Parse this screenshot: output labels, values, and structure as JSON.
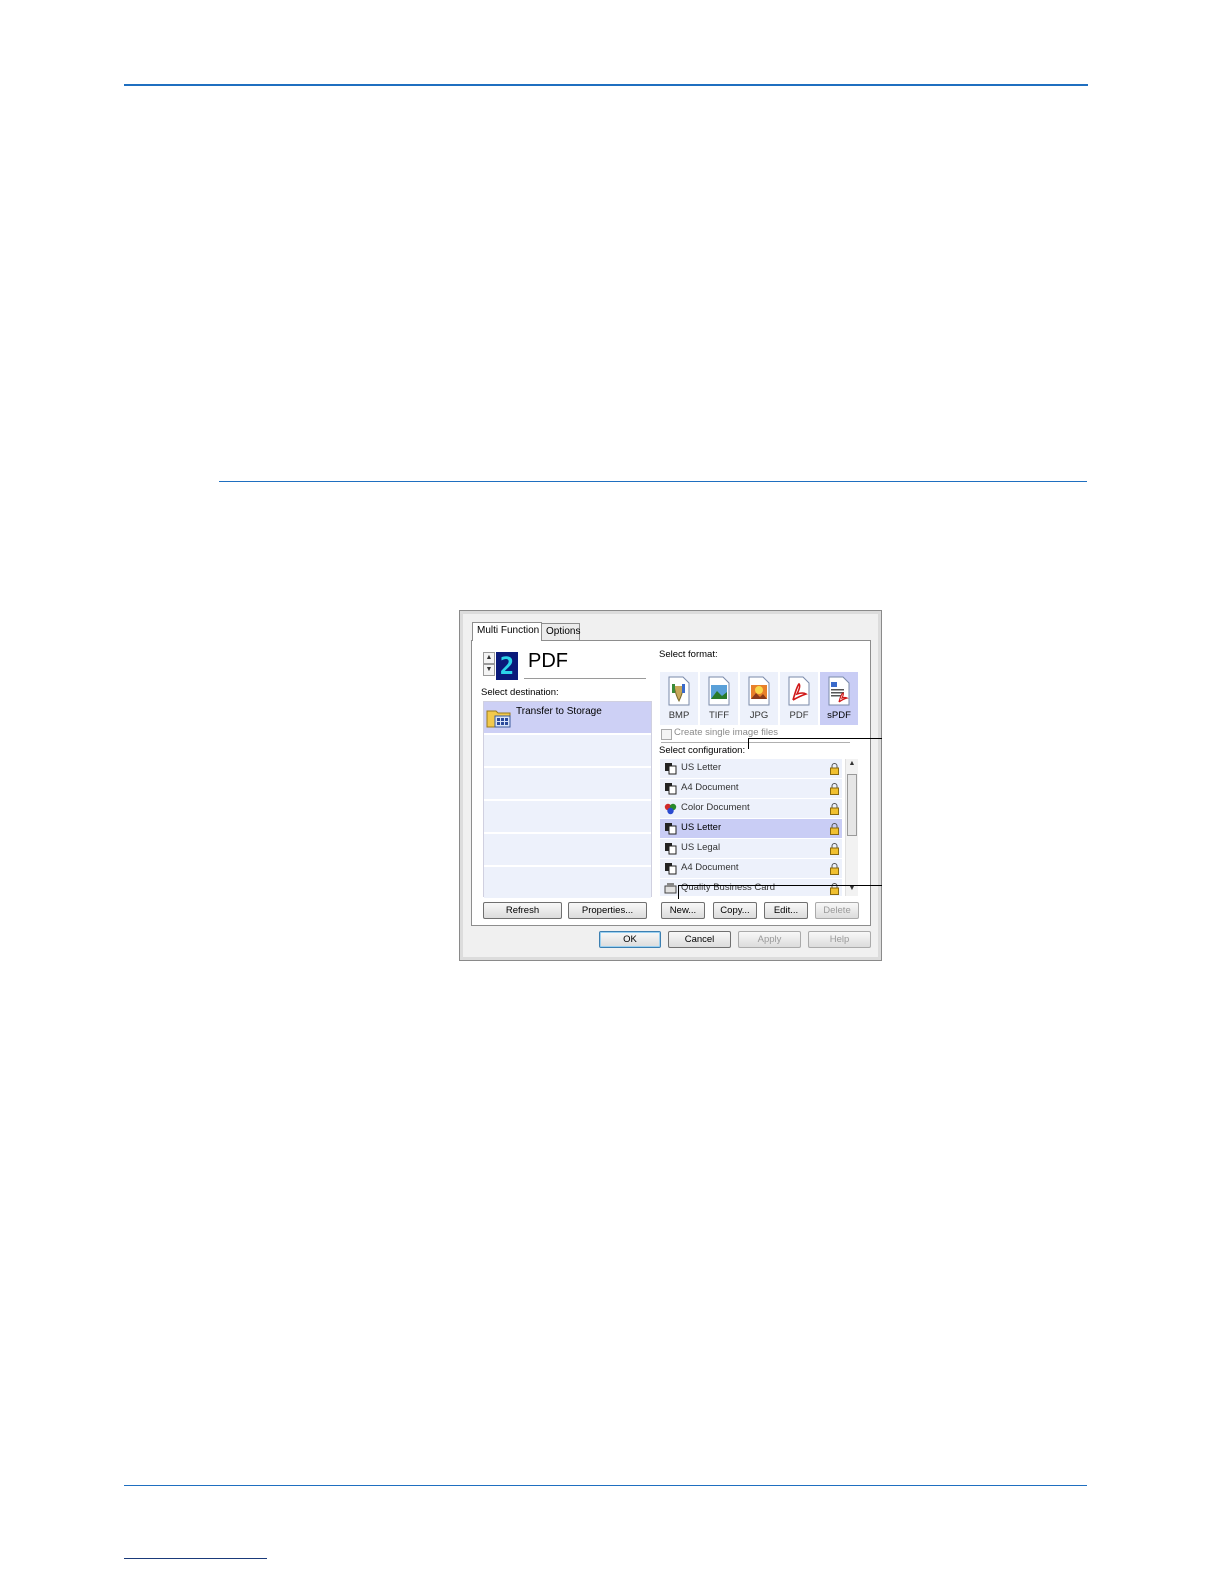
{
  "dialog": {
    "tabs": [
      "Multi Function",
      "Options"
    ],
    "profile": {
      "number": "2",
      "name": "PDF"
    },
    "select_destination_label": "Select destination:",
    "destinations": [
      {
        "label": "Transfer to Storage",
        "selected": true
      },
      {
        "label": ""
      },
      {
        "label": ""
      },
      {
        "label": ""
      },
      {
        "label": ""
      },
      {
        "label": ""
      }
    ],
    "select_format_label": "Select format:",
    "formats": [
      {
        "label": "BMP",
        "icon": "bmp-file-icon"
      },
      {
        "label": "TIFF",
        "icon": "tiff-file-icon"
      },
      {
        "label": "JPG",
        "icon": "jpg-file-icon"
      },
      {
        "label": "PDF",
        "icon": "pdf-file-icon"
      },
      {
        "label": "sPDF",
        "icon": "spdf-file-icon",
        "selected": true
      }
    ],
    "create_single_label": "Create single image files",
    "select_configuration_label": "Select configuration:",
    "configurations": [
      {
        "label": "US Letter",
        "icon": "bw-document-icon"
      },
      {
        "label": "A4 Document",
        "icon": "bw-document-icon"
      },
      {
        "label": "Color Document",
        "icon": "color-document-icon"
      },
      {
        "label": "US Letter",
        "icon": "bw-document-icon",
        "selected": true
      },
      {
        "label": "US Legal",
        "icon": "bw-document-icon"
      },
      {
        "label": "A4 Document",
        "icon": "bw-document-icon"
      },
      {
        "label": "Quality Business Card",
        "icon": "business-card-icon"
      }
    ],
    "buttons": {
      "refresh": "Refresh",
      "properties": "Properties...",
      "new": "New...",
      "copy": "Copy...",
      "edit": "Edit...",
      "delete": "Delete",
      "ok": "OK",
      "cancel": "Cancel",
      "apply": "Apply",
      "help": "Help"
    }
  },
  "colors": {
    "rule": "#1f6fc0",
    "selected_row": "#c9cdf5",
    "row": "#edf1fb"
  }
}
